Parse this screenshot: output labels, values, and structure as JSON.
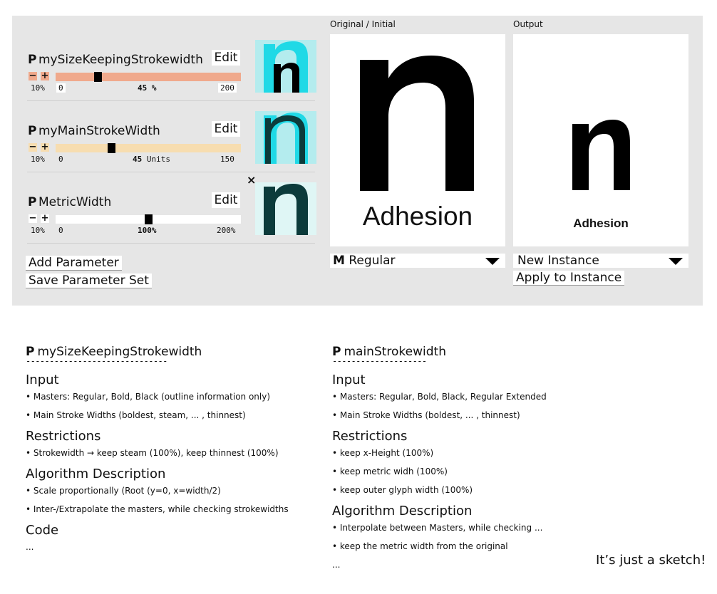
{
  "params": [
    {
      "prefix": "P",
      "name": "mySizeKeepingStrokewidth",
      "edit_label": "Edit",
      "minus": "−",
      "plus": "+",
      "min_label": "10%",
      "lo_label": "0",
      "value_label": "45",
      "unit_label": "%",
      "hi_label": "200",
      "value": 45,
      "range": [
        0,
        200
      ],
      "track_color": "#f0a98c",
      "pm_color": "#f0a98c",
      "has_close": false,
      "thumb_bg": "#b4ecee",
      "thumb_accent": "#1fd9e6"
    },
    {
      "prefix": "P",
      "name": "myMainStrokeWidth",
      "edit_label": "Edit",
      "minus": "−",
      "plus": "+",
      "min_label": "10%",
      "lo_label": "0",
      "value_label": "45",
      "unit_label": "Units",
      "hi_label": "150",
      "value": 45,
      "range": [
        0,
        150
      ],
      "track_color": "#f7ddb0",
      "pm_color": "#f7ddb0",
      "has_close": false,
      "thumb_bg": "#b4ecee",
      "thumb_accent": "#1fd9e6"
    },
    {
      "prefix": "P",
      "name": "MetricWidth",
      "edit_label": "Edit",
      "minus": "−",
      "plus": "+",
      "min_label": "10%",
      "lo_label": "0",
      "value_label": "100",
      "unit_label": "%",
      "hi_label": "200%",
      "value": 100,
      "range": [
        0,
        200
      ],
      "track_color": "#ffffff",
      "pm_color": "#ffffff",
      "has_close": true,
      "close_label": "×",
      "thumb_bg": "#dff6f5",
      "thumb_accent": "#0c3b3b"
    }
  ],
  "actions": {
    "add_parameter": "Add Parameter",
    "save_parameter_set": "Save Parameter Set"
  },
  "viewer_original": {
    "label": "Original / Initial",
    "glyph": "n",
    "word": "Adhesion",
    "dropdown_prefix": "M",
    "dropdown_value": "Regular"
  },
  "viewer_output": {
    "label": "Output",
    "glyph": "n",
    "word": "Adhesion",
    "dropdown_value": "New Instance",
    "apply_label": "Apply to Instance"
  },
  "docs": [
    {
      "prefix": "P",
      "title": "mySizeKeepingStrokewidth",
      "underline": "------------------------------",
      "sections": [
        {
          "heading": "Input",
          "bullets": [
            "• Masters: Regular, Bold, Black (outline information only)",
            "• Main Stroke Widths (boldest, steam, ... , thinnest)"
          ]
        },
        {
          "heading": "Restrictions",
          "bullets": [
            "• Strokewidth → keep steam (100%), keep thinnest (100%)"
          ]
        },
        {
          "heading": "Algorithm Description",
          "bullets": [
            "• Scale proportionally (Root (y=0, x=width/2)",
            "• Inter-/Extrapolate the masters, while checking strokewidths"
          ]
        },
        {
          "heading": "Code",
          "bullets": [
            "..."
          ]
        }
      ]
    },
    {
      "prefix": "P",
      "title": "mainStrokewidth",
      "underline": "--------------------",
      "sections": [
        {
          "heading": "Input",
          "bullets": [
            "• Masters: Regular, Bold, Black, Regular Extended",
            "• Main Stroke Widths (boldest, ... , thinnest)"
          ]
        },
        {
          "heading": "Restrictions",
          "bullets": [
            "• keep x-Height (100%)",
            "• keep metric widh (100%)",
            "• keep outer glyph width (100%)"
          ]
        },
        {
          "heading": "Algorithm Description",
          "bullets": [
            "• Interpolate between Masters, while checking ...",
            "• keep the metric width from the original",
            "..."
          ]
        }
      ]
    }
  ],
  "sketch_note": "It’s just a sketch!"
}
